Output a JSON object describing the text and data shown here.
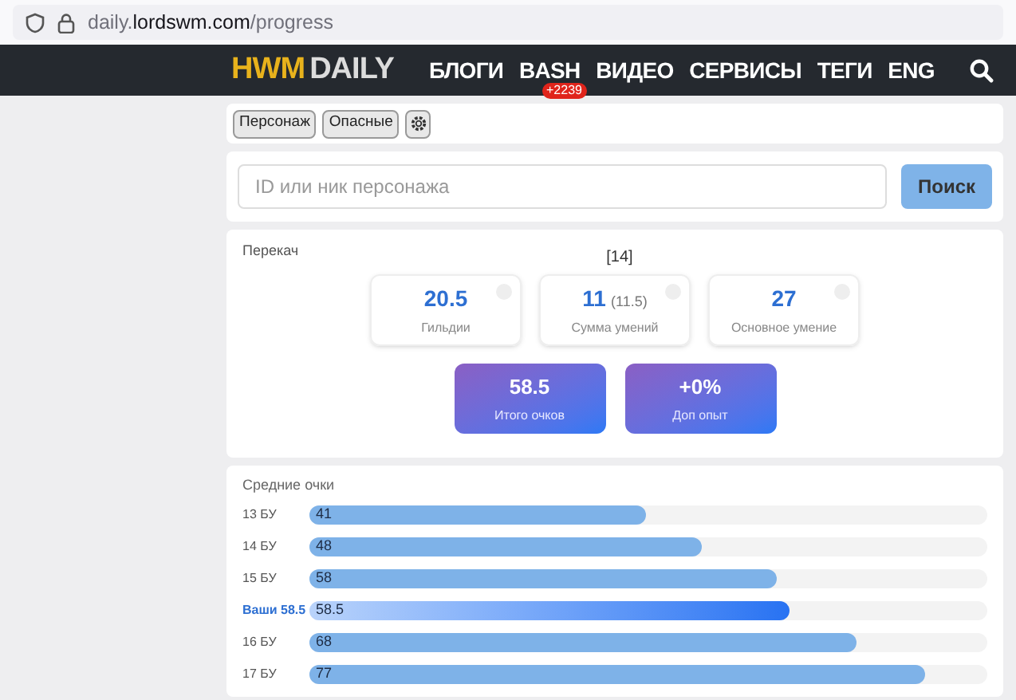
{
  "address_bar": {
    "url": "daily.**lordswm.com**/progress"
  },
  "nav": {
    "logo": [
      "HWM",
      "DAILY"
    ],
    "items": [
      {
        "label": "БЛОГИ"
      },
      {
        "label": "BASH",
        "badge": "+2239"
      },
      {
        "label": "ВИДЕО"
      },
      {
        "label": "СЕРВИСЫ"
      },
      {
        "label": "ТЕГИ"
      },
      {
        "label": "ENG"
      }
    ]
  },
  "filters": [
    "Персонаж",
    "Опасные"
  ],
  "search": {
    "placeholder": "ID или ник персонажа",
    "button": "Поиск"
  },
  "overflow": {
    "title": "Перекач",
    "level_label": "[14]",
    "stats": [
      {
        "value": "20.5",
        "label": "Гильдии"
      },
      {
        "value": "11",
        "note": "(11.5)",
        "label": "Сумма умений"
      },
      {
        "value": "27",
        "label": "Основное умение"
      }
    ],
    "totals": [
      {
        "value": "58.5",
        "label": "Итого очков"
      },
      {
        "value": "+0%",
        "label": "Доп опыт"
      }
    ]
  },
  "averages": {
    "title": "Средние очки",
    "rows": [
      {
        "label": "13 БУ",
        "value": "41",
        "level": 0.497,
        "highlighted": false
      },
      {
        "label": "14 БУ",
        "value": "48",
        "level": 0.578,
        "highlighted": false
      },
      {
        "label": "15 БУ",
        "value": "58",
        "level": 0.69,
        "highlighted": false
      },
      {
        "label": "Ваши 58.5",
        "value": "58.5",
        "level": 0.709,
        "highlighted": true
      },
      {
        "label": "16 БУ",
        "value": "68",
        "level": 0.807,
        "highlighted": false
      },
      {
        "label": "17 БУ",
        "value": "77",
        "level": 0.909,
        "highlighted": false
      }
    ]
  }
}
